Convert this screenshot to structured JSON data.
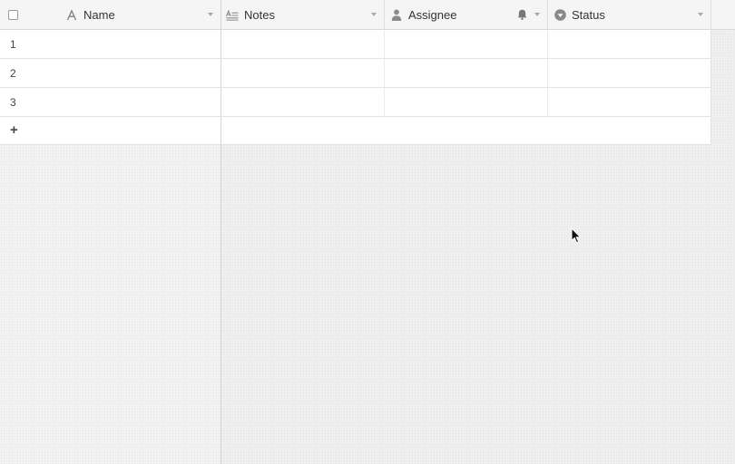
{
  "columns": [
    {
      "key": "name",
      "label": "Name",
      "icon": "text-a-icon"
    },
    {
      "key": "notes",
      "label": "Notes",
      "icon": "long-text-icon"
    },
    {
      "key": "assignee",
      "label": "Assignee",
      "icon": "user-icon"
    },
    {
      "key": "status",
      "label": "Status",
      "icon": "single-select-icon"
    }
  ],
  "rows": [
    {
      "number": "1"
    },
    {
      "number": "2"
    },
    {
      "number": "3"
    }
  ],
  "add_row_label": "+",
  "colors": {
    "icon_gray": "#8a8a8a",
    "border": "#d9d9d9"
  }
}
